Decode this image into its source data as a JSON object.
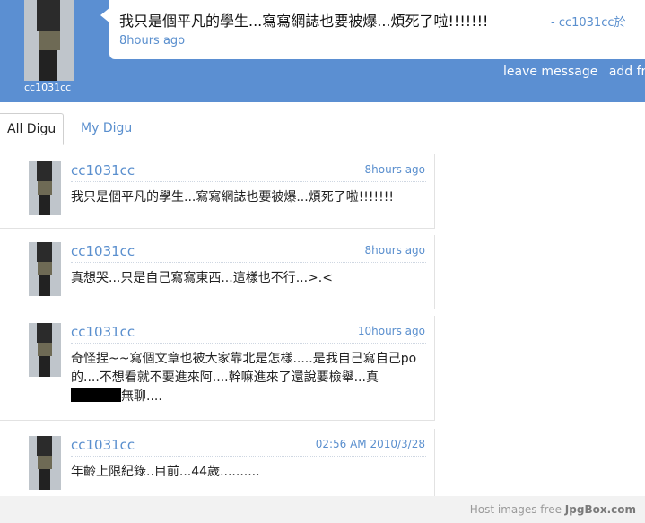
{
  "header": {
    "profile_name": "cc1031cc",
    "status_text": "我只是個平凡的學生...寫寫網誌也要被爆...煩死了啦!!!!!!!",
    "status_author": "- cc1031cc於",
    "status_time": "8hours ago",
    "links": [
      "leave message",
      "add fri"
    ],
    "band_color": "#5b8fd2"
  },
  "tabs": [
    {
      "label": "All Digu"
    },
    {
      "label": "My Digu"
    }
  ],
  "feed": [
    {
      "user": "cc1031cc",
      "time": "8hours ago",
      "message": "我只是個平凡的學生...寫寫網誌也要被爆...煩死了啦!!!!!!!"
    },
    {
      "user": "cc1031cc",
      "time": "8hours ago",
      "message": "真想哭...只是自己寫寫東西...這樣也不行...>.<"
    },
    {
      "user": "cc1031cc",
      "time": "10hours ago",
      "message_a": "奇怪捏~~寫個文章也被大家靠北是怎樣.....是我自己寫自己po的....不想看就不要進來阿....幹嘛進來了還說要檢舉...真",
      "message_b": "無聊...."
    },
    {
      "user": "cc1031cc",
      "time": "02:56 AM 2010/3/28",
      "message": "年齡上限紀錄..目前...44歲.........."
    }
  ],
  "footer": {
    "text": "Host images free",
    "brand": "JpgBox.com"
  }
}
